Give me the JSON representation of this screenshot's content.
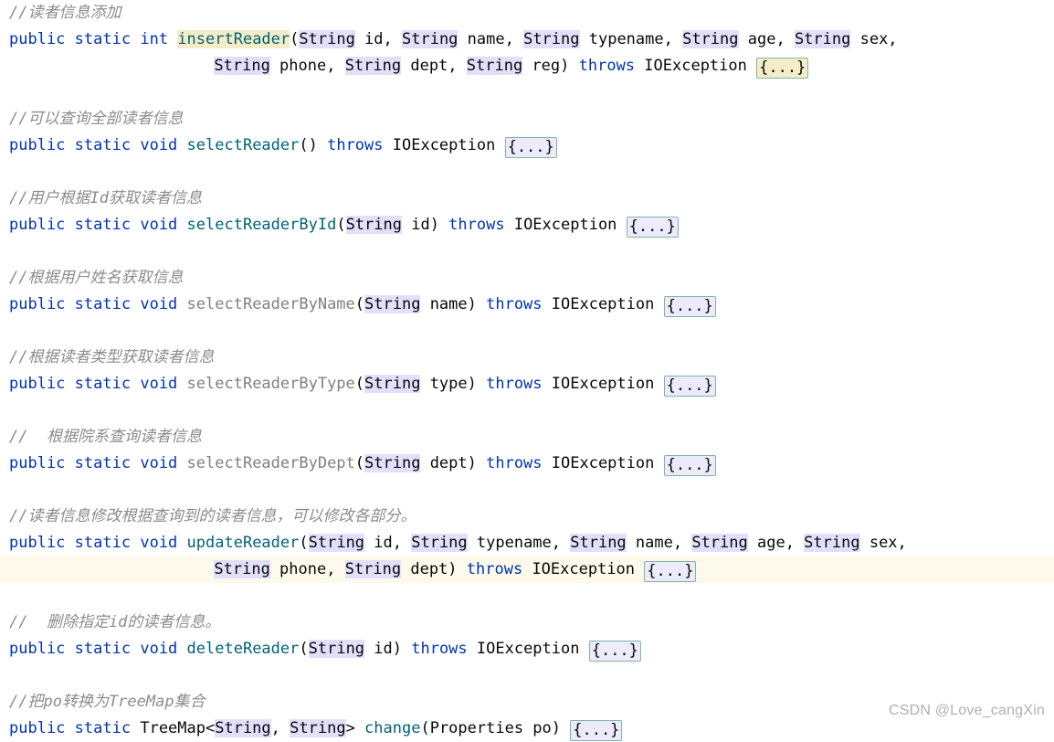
{
  "editor": {
    "language": "java",
    "theme": "light",
    "colors": {
      "background": "#ffffff",
      "keyword": "#0033b3",
      "method_teal": "#00627a",
      "method_gray": "#808080",
      "comment": "#8c8c8c",
      "plain_text": "#080808",
      "occurrence_highlight": "#e3dffb",
      "caret_word_highlight": "#f5ecc8",
      "current_line_band": "#fdfaeb",
      "fold_border": "#7fb5a3",
      "watermark": "#b0b0b0"
    },
    "lines": [
      {
        "id": "comment-insert-reader",
        "kind": "comment",
        "text": "//读者信息添加"
      },
      {
        "id": "sig-insert-reader-a",
        "kind": "code",
        "tokens": [
          {
            "t": "public",
            "c": "kw"
          },
          {
            "t": " ",
            "c": "punc"
          },
          {
            "t": "static",
            "c": "kw"
          },
          {
            "t": " ",
            "c": "punc"
          },
          {
            "t": "int",
            "c": "kw"
          },
          {
            "t": " ",
            "c": "punc"
          },
          {
            "t": "insertReader",
            "c": "mname",
            "hl": "caretword"
          },
          {
            "t": "(",
            "c": "punc"
          },
          {
            "t": "String",
            "c": "type",
            "hl": "occ"
          },
          {
            "t": " id, ",
            "c": "param"
          },
          {
            "t": "String",
            "c": "type",
            "hl": "occ"
          },
          {
            "t": " name, ",
            "c": "param"
          },
          {
            "t": "String",
            "c": "type",
            "hl": "occ"
          },
          {
            "t": " typename, ",
            "c": "param"
          },
          {
            "t": "String",
            "c": "type",
            "hl": "occ"
          },
          {
            "t": " age, ",
            "c": "param"
          },
          {
            "t": "String",
            "c": "type",
            "hl": "occ"
          },
          {
            "t": " sex,",
            "c": "param"
          }
        ]
      },
      {
        "id": "sig-insert-reader-b",
        "kind": "code",
        "indent": 22,
        "tokens": [
          {
            "t": "String",
            "c": "type",
            "hl": "occ"
          },
          {
            "t": " phone, ",
            "c": "param"
          },
          {
            "t": "String",
            "c": "type",
            "hl": "occ"
          },
          {
            "t": " dept, ",
            "c": "param"
          },
          {
            "t": "String",
            "c": "type",
            "hl": "occ"
          },
          {
            "t": " reg) ",
            "c": "param"
          },
          {
            "t": "throws",
            "c": "kw"
          },
          {
            "t": " IOException ",
            "c": "type"
          },
          {
            "t": "{...}",
            "c": "fold",
            "fold": "cream"
          }
        ]
      },
      {
        "id": "blank-1",
        "kind": "blank",
        "text": ""
      },
      {
        "id": "comment-select-reader",
        "kind": "comment",
        "text": "//可以查询全部读者信息"
      },
      {
        "id": "sig-select-reader",
        "kind": "code",
        "tokens": [
          {
            "t": "public",
            "c": "kw"
          },
          {
            "t": " ",
            "c": "punc"
          },
          {
            "t": "static",
            "c": "kw"
          },
          {
            "t": " ",
            "c": "punc"
          },
          {
            "t": "void",
            "c": "kw"
          },
          {
            "t": " ",
            "c": "punc"
          },
          {
            "t": "selectReader",
            "c": "mname"
          },
          {
            "t": "() ",
            "c": "punc"
          },
          {
            "t": "throws",
            "c": "kw"
          },
          {
            "t": " IOException ",
            "c": "type"
          },
          {
            "t": "{...}",
            "c": "fold",
            "fold": "lavender"
          }
        ]
      },
      {
        "id": "blank-2",
        "kind": "blank",
        "text": ""
      },
      {
        "id": "comment-select-reader-by-id",
        "kind": "comment",
        "text": "//用户根据Id获取读者信息"
      },
      {
        "id": "sig-select-reader-by-id",
        "kind": "code",
        "tokens": [
          {
            "t": "public",
            "c": "kw"
          },
          {
            "t": " ",
            "c": "punc"
          },
          {
            "t": "static",
            "c": "kw"
          },
          {
            "t": " ",
            "c": "punc"
          },
          {
            "t": "void",
            "c": "kw"
          },
          {
            "t": " ",
            "c": "punc"
          },
          {
            "t": "selectReaderById",
            "c": "mname"
          },
          {
            "t": "(",
            "c": "punc"
          },
          {
            "t": "String",
            "c": "type",
            "hl": "occ"
          },
          {
            "t": " id) ",
            "c": "param"
          },
          {
            "t": "throws",
            "c": "kw"
          },
          {
            "t": " IOException ",
            "c": "type"
          },
          {
            "t": "{...}",
            "c": "fold",
            "fold": "lavender"
          }
        ]
      },
      {
        "id": "blank-3",
        "kind": "blank",
        "text": ""
      },
      {
        "id": "comment-select-reader-by-name",
        "kind": "comment",
        "text": "//根据用户姓名获取信息"
      },
      {
        "id": "sig-select-reader-by-name",
        "kind": "code",
        "tokens": [
          {
            "t": "public",
            "c": "kw"
          },
          {
            "t": " ",
            "c": "punc"
          },
          {
            "t": "static",
            "c": "kw"
          },
          {
            "t": " ",
            "c": "punc"
          },
          {
            "t": "void",
            "c": "kw"
          },
          {
            "t": " ",
            "c": "punc"
          },
          {
            "t": "selectReaderByName",
            "c": "mname-g"
          },
          {
            "t": "(",
            "c": "punc"
          },
          {
            "t": "String",
            "c": "type",
            "hl": "occ"
          },
          {
            "t": " name) ",
            "c": "param"
          },
          {
            "t": "throws",
            "c": "kw"
          },
          {
            "t": " IOException ",
            "c": "type"
          },
          {
            "t": "{...}",
            "c": "fold",
            "fold": "lavender"
          }
        ]
      },
      {
        "id": "blank-4",
        "kind": "blank",
        "text": ""
      },
      {
        "id": "comment-select-reader-by-type",
        "kind": "comment",
        "text": "//根据读者类型获取读者信息"
      },
      {
        "id": "sig-select-reader-by-type",
        "kind": "code",
        "tokens": [
          {
            "t": "public",
            "c": "kw"
          },
          {
            "t": " ",
            "c": "punc"
          },
          {
            "t": "static",
            "c": "kw"
          },
          {
            "t": " ",
            "c": "punc"
          },
          {
            "t": "void",
            "c": "kw"
          },
          {
            "t": " ",
            "c": "punc"
          },
          {
            "t": "selectReaderByType",
            "c": "mname-g"
          },
          {
            "t": "(",
            "c": "punc"
          },
          {
            "t": "String",
            "c": "type",
            "hl": "occ"
          },
          {
            "t": " type) ",
            "c": "param"
          },
          {
            "t": "throws",
            "c": "kw"
          },
          {
            "t": " IOException ",
            "c": "type"
          },
          {
            "t": "{...}",
            "c": "fold",
            "fold": "lavender"
          }
        ]
      },
      {
        "id": "blank-5",
        "kind": "blank",
        "text": ""
      },
      {
        "id": "comment-select-reader-by-dept",
        "kind": "comment",
        "text": "//  根据院系查询读者信息"
      },
      {
        "id": "sig-select-reader-by-dept",
        "kind": "code",
        "tokens": [
          {
            "t": "public",
            "c": "kw"
          },
          {
            "t": " ",
            "c": "punc"
          },
          {
            "t": "static",
            "c": "kw"
          },
          {
            "t": " ",
            "c": "punc"
          },
          {
            "t": "void",
            "c": "kw"
          },
          {
            "t": " ",
            "c": "punc"
          },
          {
            "t": "selectReaderByDept",
            "c": "mname-g"
          },
          {
            "t": "(",
            "c": "punc"
          },
          {
            "t": "String",
            "c": "type",
            "hl": "occ"
          },
          {
            "t": " dept) ",
            "c": "param"
          },
          {
            "t": "throws",
            "c": "kw"
          },
          {
            "t": " IOException ",
            "c": "type"
          },
          {
            "t": "{...}",
            "c": "fold",
            "fold": "lavender"
          }
        ]
      },
      {
        "id": "blank-6",
        "kind": "blank",
        "text": ""
      },
      {
        "id": "comment-update-reader",
        "kind": "comment",
        "text": "//读者信息修改根据查询到的读者信息，可以修改各部分。"
      },
      {
        "id": "sig-update-reader-a",
        "kind": "code",
        "tokens": [
          {
            "t": "public",
            "c": "kw"
          },
          {
            "t": " ",
            "c": "punc"
          },
          {
            "t": "static",
            "c": "kw"
          },
          {
            "t": " ",
            "c": "punc"
          },
          {
            "t": "void",
            "c": "kw"
          },
          {
            "t": " ",
            "c": "punc"
          },
          {
            "t": "updateReader",
            "c": "mname"
          },
          {
            "t": "(",
            "c": "punc"
          },
          {
            "t": "String",
            "c": "type",
            "hl": "occ"
          },
          {
            "t": " id, ",
            "c": "param"
          },
          {
            "t": "String",
            "c": "type",
            "hl": "occ"
          },
          {
            "t": " typename, ",
            "c": "param"
          },
          {
            "t": "String",
            "c": "type",
            "hl": "occ"
          },
          {
            "t": " name, ",
            "c": "param"
          },
          {
            "t": "String",
            "c": "type",
            "hl": "occ"
          },
          {
            "t": " age, ",
            "c": "param"
          },
          {
            "t": "String",
            "c": "type",
            "hl": "occ"
          },
          {
            "t": " sex,",
            "c": "param"
          }
        ]
      },
      {
        "id": "sig-update-reader-b",
        "kind": "code",
        "indent": 22,
        "band": true,
        "tokens": [
          {
            "t": "String",
            "c": "type",
            "hl": "occ"
          },
          {
            "t": " phone, ",
            "c": "param"
          },
          {
            "t": "String",
            "c": "type",
            "hl": "occ"
          },
          {
            "t": " dept) ",
            "c": "param"
          },
          {
            "t": "throws",
            "c": "kw"
          },
          {
            "t": " IOException ",
            "c": "type"
          },
          {
            "t": "{...}",
            "c": "fold",
            "fold": "lavender"
          }
        ]
      },
      {
        "id": "blank-7",
        "kind": "blank",
        "text": ""
      },
      {
        "id": "comment-delete-reader",
        "kind": "comment",
        "text": "//  删除指定id的读者信息。"
      },
      {
        "id": "sig-delete-reader",
        "kind": "code",
        "tokens": [
          {
            "t": "public",
            "c": "kw"
          },
          {
            "t": " ",
            "c": "punc"
          },
          {
            "t": "static",
            "c": "kw"
          },
          {
            "t": " ",
            "c": "punc"
          },
          {
            "t": "void",
            "c": "kw"
          },
          {
            "t": " ",
            "c": "punc"
          },
          {
            "t": "deleteReader",
            "c": "mname"
          },
          {
            "t": "(",
            "c": "punc"
          },
          {
            "t": "String",
            "c": "type",
            "hl": "occ"
          },
          {
            "t": " id) ",
            "c": "param"
          },
          {
            "t": "throws",
            "c": "kw"
          },
          {
            "t": " IOException ",
            "c": "type"
          },
          {
            "t": "{...}",
            "c": "fold",
            "fold": "lavender"
          }
        ]
      },
      {
        "id": "blank-8",
        "kind": "blank",
        "text": ""
      },
      {
        "id": "comment-change",
        "kind": "comment",
        "text": "//把po转换为TreeMap集合"
      },
      {
        "id": "sig-change",
        "kind": "code",
        "tokens": [
          {
            "t": "public",
            "c": "kw"
          },
          {
            "t": " ",
            "c": "punc"
          },
          {
            "t": "static",
            "c": "kw"
          },
          {
            "t": " ",
            "c": "punc"
          },
          {
            "t": "TreeMap<",
            "c": "type"
          },
          {
            "t": "String",
            "c": "type",
            "hl": "occ"
          },
          {
            "t": ", ",
            "c": "punc"
          },
          {
            "t": "String",
            "c": "type",
            "hl": "occ"
          },
          {
            "t": "> ",
            "c": "punc"
          },
          {
            "t": "change",
            "c": "mname"
          },
          {
            "t": "(Properties po) ",
            "c": "type"
          },
          {
            "t": "{...}",
            "c": "fold",
            "fold": "lavender"
          }
        ]
      }
    ]
  },
  "watermark": {
    "text": "CSDN @Love_cangXin"
  }
}
